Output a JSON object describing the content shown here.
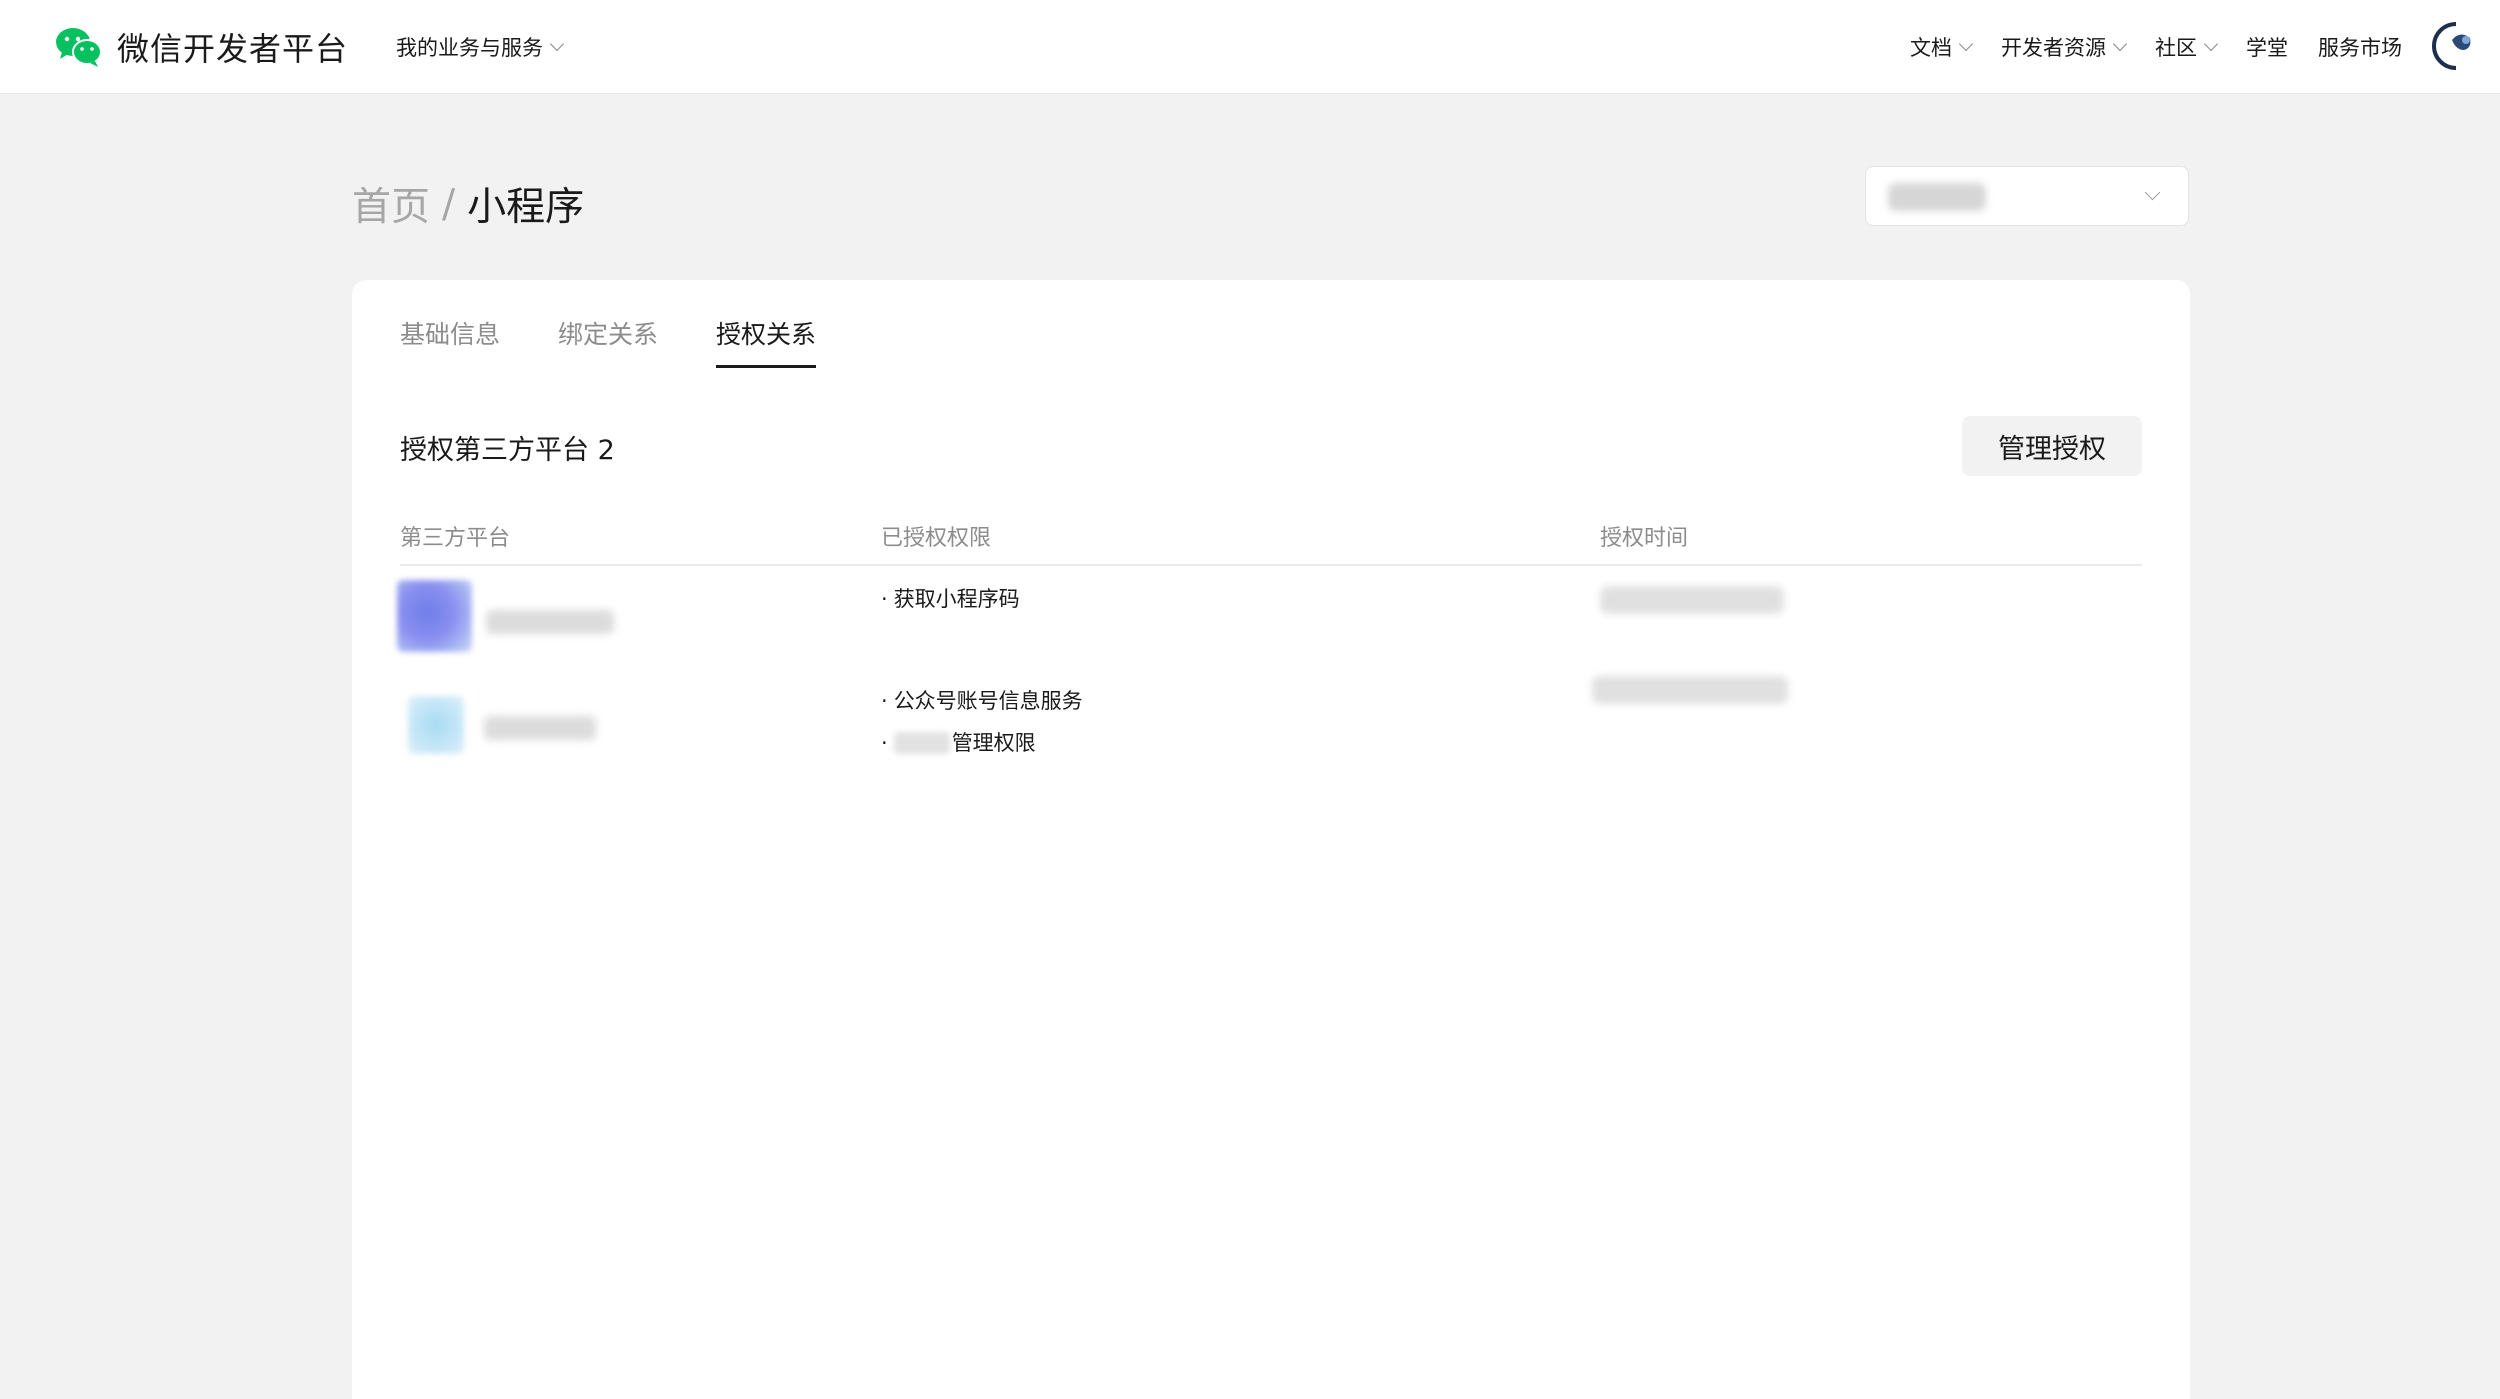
{
  "header": {
    "brand_title": "微信开发者平台",
    "brand_icon": "wechat-logo-icon",
    "brand_color": "#07c160",
    "business_menu": "我的业务与服务",
    "nav": [
      "文档",
      "开发者资源",
      "社区",
      "学堂",
      "服务市场"
    ],
    "nav_has_dropdown": [
      true,
      true,
      true,
      false,
      false
    ]
  },
  "breadcrumb": {
    "home": "首页",
    "separator": "/",
    "current": "小程序"
  },
  "tabs": [
    "基础信息",
    "绑定关系",
    "授权关系"
  ],
  "active_tab": "授权关系",
  "section": {
    "title": "授权第三方平台 2",
    "manage_button": "管理授权"
  },
  "table": {
    "headers": [
      "第三方平台",
      "已授权权限",
      "授权时间"
    ],
    "rows": [
      {
        "permissions": [
          "获取小程序码"
        ]
      },
      {
        "permissions": [
          "公众号账号信息服务",
          "管理权限"
        ],
        "second_permission_prefix_redacted": true
      }
    ]
  }
}
